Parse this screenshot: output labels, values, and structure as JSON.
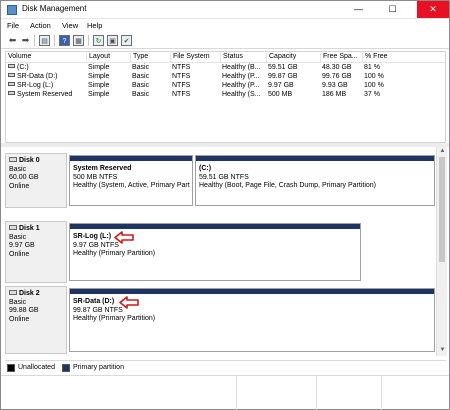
{
  "window": {
    "title": "Disk Management",
    "min_glyph": "—",
    "max_glyph": "☐",
    "close_glyph": "✕"
  },
  "menu": [
    "File",
    "Action",
    "View",
    "Help"
  ],
  "toolbar": [
    {
      "name": "back-icon",
      "glyph": "⬅"
    },
    {
      "name": "forward-icon",
      "glyph": "➡"
    },
    {
      "name": "console-tree-icon",
      "glyph": "▤"
    },
    {
      "name": "help-icon",
      "glyph": "?"
    },
    {
      "name": "properties-icon",
      "glyph": "▦"
    },
    {
      "name": "refresh-icon",
      "glyph": "↻"
    },
    {
      "name": "connect-icon",
      "glyph": "▣"
    },
    {
      "name": "rescan-icon",
      "glyph": "✔"
    }
  ],
  "volume_list": {
    "columns": [
      "Volume",
      "Layout",
      "Type",
      "File System",
      "Status",
      "Capacity",
      "Free Spa...",
      "% Free"
    ],
    "rows": [
      [
        "(C:)",
        "Simple",
        "Basic",
        "NTFS",
        "Healthy (B...",
        "59.51 GB",
        "48.30 GB",
        "81 %"
      ],
      [
        "SR-Data (D:)",
        "Simple",
        "Basic",
        "NTFS",
        "Healthy (P...",
        "99.87 GB",
        "99.76 GB",
        "100 %"
      ],
      [
        "SR-Log (L:)",
        "Simple",
        "Basic",
        "NTFS",
        "Healthy (P...",
        "9.97 GB",
        "9.93 GB",
        "100 %"
      ],
      [
        "System Reserved",
        "Simple",
        "Basic",
        "NTFS",
        "Healthy (S...",
        "500 MB",
        "186 MB",
        "37 %"
      ]
    ]
  },
  "disks": [
    {
      "name": "Disk 0",
      "type": "Basic",
      "size": "60.00 GB",
      "status": "Online",
      "partitions": [
        {
          "name": "System Reserved",
          "size": "500 MB NTFS",
          "status": "Healthy (System, Active, Primary Part"
        },
        {
          "name": "(C:)",
          "size": "59.51 GB NTFS",
          "status": "Healthy (Boot, Page File, Crash Dump, Primary Partition)"
        }
      ]
    },
    {
      "name": "Disk 1",
      "type": "Basic",
      "size": "9.97 GB",
      "status": "Online",
      "partitions": [
        {
          "name": "SR-Log  (L:)",
          "size": "9.97 GB NTFS",
          "status": "Healthy (Primary Partition)"
        }
      ]
    },
    {
      "name": "Disk 2",
      "type": "Basic",
      "size": "99.88 GB",
      "status": "Online",
      "partitions": [
        {
          "name": "SR-Data  (D:)",
          "size": "99.87 GB NTFS",
          "status": "Healthy (Primary Partition)"
        }
      ]
    }
  ],
  "legend": {
    "unallocated": {
      "label": "Unallocated",
      "color": "#000000"
    },
    "primary": {
      "label": "Primary partition",
      "color": "#1f3464"
    }
  },
  "colors": {
    "close_button": "#e81123",
    "partition_header": "#1f3464",
    "highlight_arrow": "#cc1a1a"
  },
  "scrollbar": {
    "up_glyph": "▲",
    "down_glyph": "▼"
  }
}
